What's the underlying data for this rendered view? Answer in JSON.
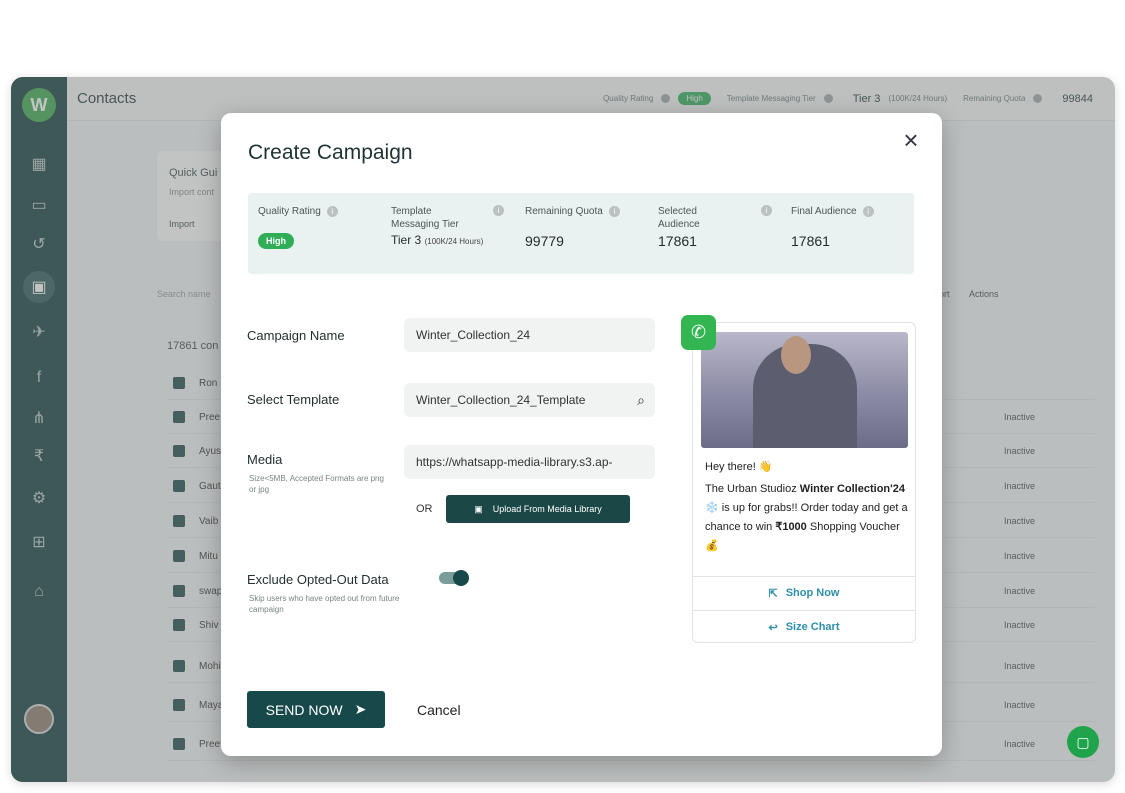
{
  "app": {
    "page_title": "Contacts",
    "top_stats": {
      "quality_rating_label": "Quality Rating",
      "quality_rating_value": "High",
      "tier_label": "Template Messaging Tier",
      "tier_value": "Tier 3",
      "tier_sub": "(100K/24 Hours)",
      "quota_label": "Remaining Quota",
      "quota_value": "99844"
    },
    "background": {
      "quick_guide": "Quick Gui",
      "import_text": "Import cont",
      "import_btn": "Import",
      "search_placeholder": "Search name",
      "contacts_count": "17861 con",
      "export_btn": "ort",
      "actions_btn": "Actions",
      "rows": [
        {
          "name": "Ron",
          "status": ""
        },
        {
          "name": "Pree",
          "status": "Inactive"
        },
        {
          "name": "Ayus",
          "status": "Inactive"
        },
        {
          "name": "Gaut",
          "status": "Inactive"
        },
        {
          "name": "Vaib",
          "status": "Inactive"
        },
        {
          "name": "Mitu",
          "status": "Inactive"
        },
        {
          "name": "swap",
          "status": "Inactive"
        },
        {
          "name": "Shiv",
          "status": "Inactive"
        },
        {
          "name": "Mohi",
          "status": "Inactive"
        },
        {
          "name": "Maya",
          "status": "Inactive"
        },
        {
          "name": "Preet",
          "status": "Inactive"
        }
      ]
    }
  },
  "modal": {
    "title": "Create Campaign",
    "close_icon": "close-icon",
    "stats": {
      "quality_rating_label": "Quality Rating",
      "quality_rating_value": "High",
      "tier_label": "Template Messaging Tier",
      "tier_value": "Tier 3",
      "tier_sub": "(100K/24 Hours)",
      "quota_label": "Remaining Quota",
      "quota_value": "99779",
      "selected_label": "Selected Audience",
      "selected_value": "17861",
      "final_label": "Final Audience",
      "final_value": "17861"
    },
    "campaign_name_label": "Campaign Name",
    "campaign_name_value": "Winter_Collection_24",
    "template_label": "Select Template",
    "template_value": "Winter_Collection_24_Template",
    "media_label": "Media",
    "media_sub": "Size<5MB, Accepted Formats are png or jpg",
    "media_value": "https://whatsapp-media-library.s3.ap-",
    "or_text": "OR",
    "upload_label": "Upload From Media Library",
    "exclude_label": "Exclude Opted-Out Data",
    "exclude_sub": "Skip users who have opted out from future campaign",
    "exclude_enabled": true,
    "send_label": "SEND NOW",
    "cancel_label": "Cancel"
  },
  "preview": {
    "greeting": "Hey there! 👋",
    "line1_pre": "The Urban Studioz ",
    "line1_bold": "Winter Collection'24",
    "line1_post": " ❄️ is up for grabs!! Order today and get a chance to win ",
    "voucher_bold": "₹1000",
    "voucher_post": " Shopping Voucher💰",
    "shop_label": "Shop Now",
    "size_label": "Size Chart"
  },
  "colors": {
    "brand_dark": "#17484a",
    "accent_green": "#2fae57",
    "link_blue": "#2e8fa8"
  }
}
